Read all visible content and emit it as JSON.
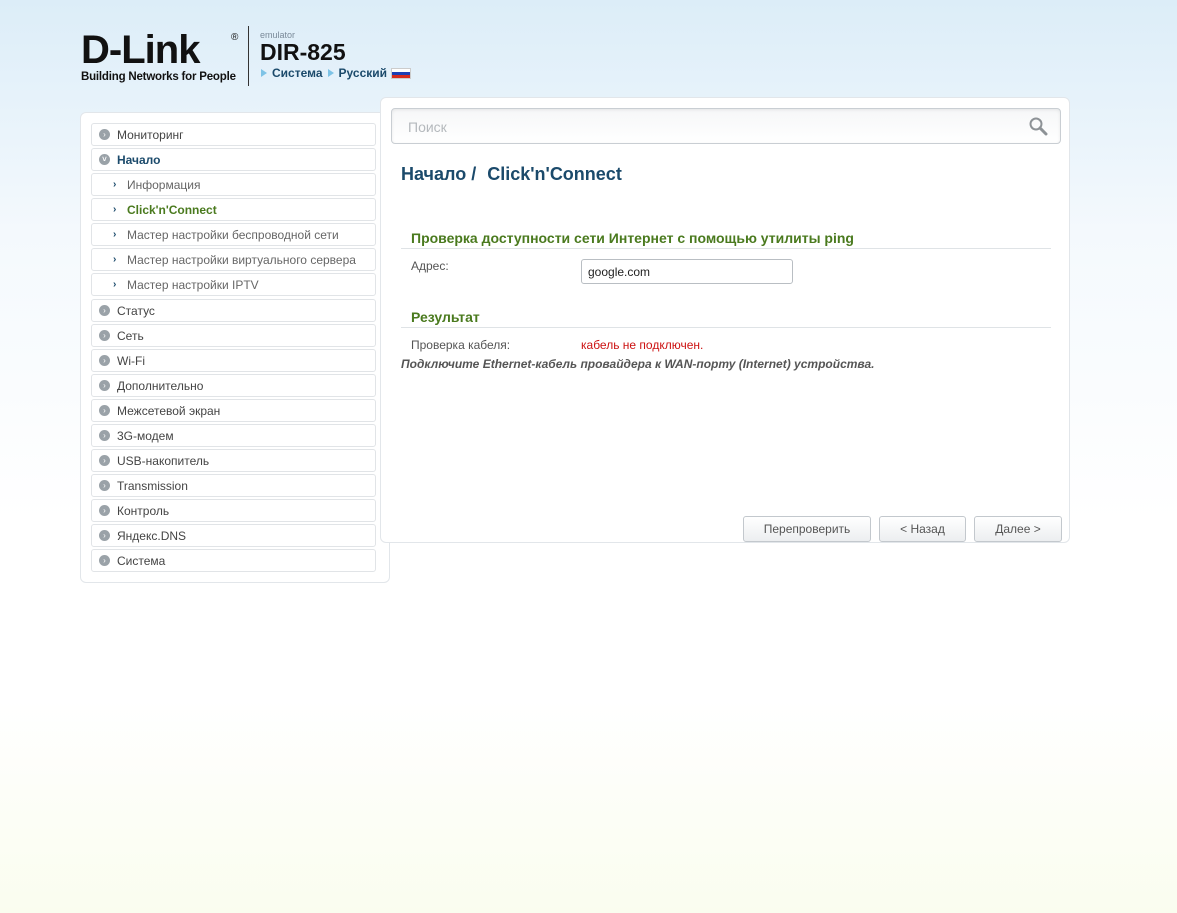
{
  "header": {
    "logo_text": "D-Link",
    "logo_reg": "®",
    "logo_tagline": "Building Networks for People",
    "emulator_label": "emulator",
    "model": "DIR-825",
    "link_system": "Система",
    "link_language": "Русский"
  },
  "search": {
    "placeholder": "Поиск",
    "value": ""
  },
  "sidebar": {
    "items": [
      {
        "label": "Мониторинг",
        "type": "top",
        "state": "collapsed"
      },
      {
        "label": "Начало",
        "type": "top",
        "state": "expanded"
      },
      {
        "label": "Информация",
        "type": "sub"
      },
      {
        "label": "Click'n'Connect",
        "type": "sub",
        "state": "active"
      },
      {
        "label": "Мастер настройки беспроводной сети",
        "type": "sub"
      },
      {
        "label": "Мастер настройки виртуального сервера",
        "type": "sub"
      },
      {
        "label": "Мастер настройки IPTV",
        "type": "sub"
      },
      {
        "label": "Статус",
        "type": "top",
        "state": "collapsed"
      },
      {
        "label": "Сеть",
        "type": "top",
        "state": "collapsed"
      },
      {
        "label": "Wi-Fi",
        "type": "top",
        "state": "collapsed"
      },
      {
        "label": "Дополнительно",
        "type": "top",
        "state": "collapsed"
      },
      {
        "label": "Межсетевой экран",
        "type": "top",
        "state": "collapsed"
      },
      {
        "label": "3G-модем",
        "type": "top",
        "state": "collapsed"
      },
      {
        "label": "USB-накопитель",
        "type": "top",
        "state": "collapsed"
      },
      {
        "label": "Transmission",
        "type": "top",
        "state": "collapsed"
      },
      {
        "label": "Контроль",
        "type": "top",
        "state": "collapsed"
      },
      {
        "label": "Яндекс.DNS",
        "type": "top",
        "state": "collapsed"
      },
      {
        "label": "Система",
        "type": "top",
        "state": "collapsed"
      }
    ]
  },
  "main": {
    "breadcrumb_parent": "Начало /",
    "breadcrumb_current": "Click'n'Connect",
    "ping_section_title": "Проверка доступности сети Интернет с помощью утилиты ping",
    "address_label": "Адрес:",
    "address_value": "google.com",
    "result_section_title": "Результат",
    "cable_check_label": "Проверка кабеля:",
    "cable_check_value": "кабель не подключен.",
    "note": "Подключите Ethernet-кабель провайдера к WAN-порту (Internet) устройства."
  },
  "buttons": {
    "recheck": "Перепроверить",
    "back": "< Назад",
    "next": "Далее >"
  },
  "colors": {
    "title_blue": "#1b4a6b",
    "section_green": "#4a7a1e",
    "error_red": "#cc1111"
  }
}
